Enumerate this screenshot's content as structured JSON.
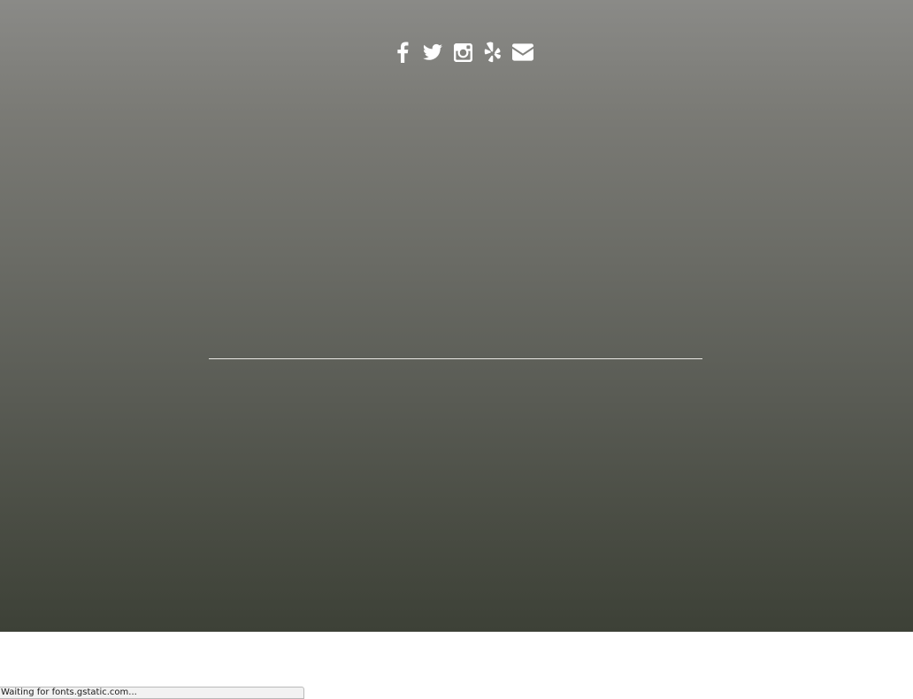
{
  "social": {
    "items": [
      {
        "icon": "facebook-icon"
      },
      {
        "icon": "twitter-icon"
      },
      {
        "icon": "instagram-icon"
      },
      {
        "icon": "yelp-icon"
      },
      {
        "icon": "email-icon"
      }
    ]
  },
  "colors": {
    "hero_top": "#8a8a87",
    "hero_bottom": "#3d4137",
    "icon": "#ffffff",
    "divider": "#e8e8e4"
  },
  "status_bar": {
    "text": "Waiting for fonts.gstatic.com..."
  }
}
